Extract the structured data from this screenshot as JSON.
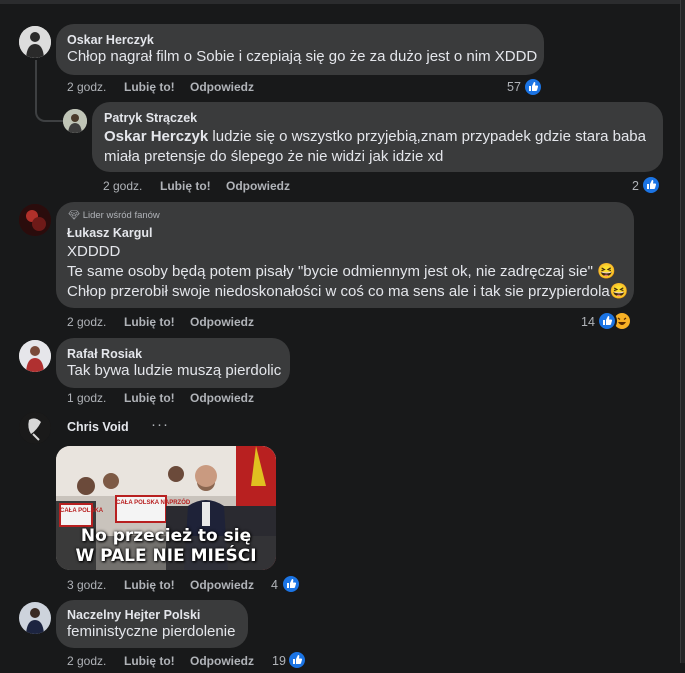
{
  "comments": [
    {
      "name": "Oskar Herczyk",
      "text": "Chłop nagrał film o Sobie i czepiają się go że za dużo jest o nim XDDD",
      "time": "2 godz.",
      "like": "Lubię to!",
      "reply": "Odpowiedz",
      "likes": "57",
      "reactions": [
        "like-icon"
      ]
    },
    {
      "name": "Patryk Strączek",
      "mention": "Oskar Herczyk",
      "text_line1": " ludzie się o wszystko przyjebią,znam przypadek gdzie stara baba",
      "text_line2": "miała pretensje do ślepego że nie widzi jak idzie xd",
      "time": "2 godz.",
      "like": "Lubię to!",
      "reply": "Odpowiedz",
      "likes": "2",
      "reactions": [
        "like-icon"
      ]
    },
    {
      "badge": "Lider wśród fanów",
      "name": "Łukasz Kargul",
      "line1": "XDDDD",
      "line2": "Te same osoby będą potem pisały \"bycie odmiennym jest ok, nie zadręczaj sie\" 😆",
      "line3": "Chłop przerobił swoje niedoskonałości w coś co ma sens ale i tak sie przypierdola😆",
      "time": "2 godz.",
      "like": "Lubię to!",
      "reply": "Odpowiedz",
      "likes": "14",
      "reactions": [
        "like-icon",
        "haha-icon"
      ]
    },
    {
      "name": "Rafał Rosiak",
      "text": "Tak bywa ludzie muszą pierdolic",
      "time": "1 godz.",
      "like": "Lubię to!",
      "reply": "Odpowiedz"
    },
    {
      "name": "Chris Void",
      "more": "···",
      "gif_caption_1": "No przecież to się",
      "gif_caption_2": "W PALE NIE MIEŚCI",
      "sign_1": "CAŁA POLSKA",
      "sign_2": "CAŁA POLSKA NAPRZÓD",
      "time": "3 godz.",
      "like": "Lubię to!",
      "reply": "Odpowiedz",
      "likes": "4",
      "reactions": [
        "like-icon"
      ]
    },
    {
      "name": "Naczelny Hejter Polski",
      "text": "feministyczne pierdolenie",
      "time": "2 godz.",
      "like": "Lubię to!",
      "reply": "Odpowiedz",
      "likes": "19",
      "reactions": [
        "like-icon"
      ]
    }
  ],
  "colors": {
    "background": "#18191a",
    "bubble": "#3a3b3c",
    "text": "#e4e6eb",
    "secondary": "#b0b3b8",
    "like_blue": "#1b74e4",
    "haha_yellow": "#f7b125"
  }
}
